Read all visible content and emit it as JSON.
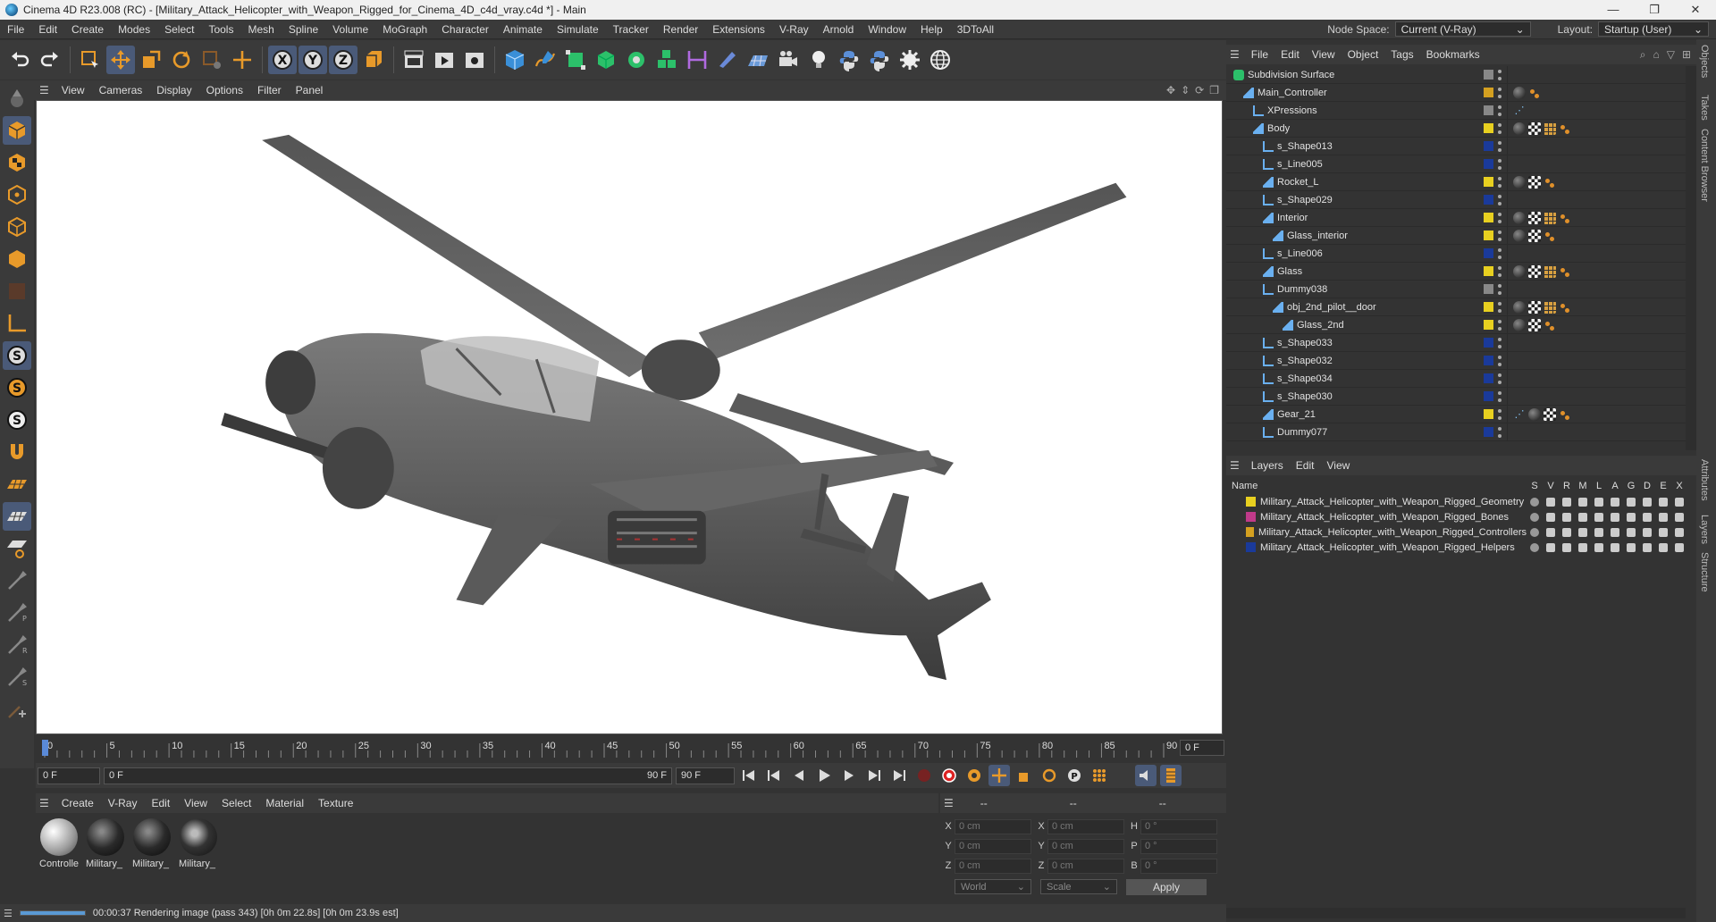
{
  "window": {
    "title": "Cinema 4D R23.008 (RC) - [Military_Attack_Helicopter_with_Weapon_Rigged_for_Cinema_4D_c4d_vray.c4d *] - Main",
    "controls": [
      "—",
      "❐",
      "✕"
    ]
  },
  "menubar": {
    "items": [
      "File",
      "Edit",
      "Create",
      "Modes",
      "Select",
      "Tools",
      "Mesh",
      "Spline",
      "Volume",
      "MoGraph",
      "Character",
      "Animate",
      "Simulate",
      "Tracker",
      "Render",
      "Extensions",
      "V-Ray",
      "Arnold",
      "Window",
      "Help",
      "3DToAll"
    ],
    "node_space_label": "Node Space:",
    "node_space_value": "Current (V-Ray)",
    "layout_label": "Layout:",
    "layout_value": "Startup (User)"
  },
  "viewport": {
    "menu": [
      "View",
      "Cameras",
      "Display",
      "Options",
      "Filter",
      "Panel"
    ]
  },
  "timeline": {
    "ticks": [
      "0",
      "5",
      "10",
      "15",
      "20",
      "25",
      "30",
      "35",
      "40",
      "45",
      "50",
      "55",
      "60",
      "65",
      "70",
      "75",
      "80",
      "85",
      "90"
    ],
    "current_frame": "0 F",
    "start_field": "0 F",
    "range_start": "0 F",
    "range_end": "90 F",
    "end_field": "90 F"
  },
  "material_manager": {
    "menu": [
      "Create",
      "V-Ray",
      "Edit",
      "View",
      "Select",
      "Material",
      "Texture"
    ],
    "materials": [
      {
        "label": "Controlle",
        "style": "white"
      },
      {
        "label": "Military_",
        "style": "dark"
      },
      {
        "label": "Military_",
        "style": "dark"
      },
      {
        "label": "Military_",
        "style": "face"
      }
    ]
  },
  "coordinates": {
    "header": [
      "--",
      "--",
      "--"
    ],
    "rows": [
      {
        "a1": "X",
        "v1": "0 cm",
        "a2": "X",
        "v2": "0 cm",
        "a3": "H",
        "v3": "0 °"
      },
      {
        "a1": "Y",
        "v1": "0 cm",
        "a2": "Y",
        "v2": "0 cm",
        "a3": "P",
        "v3": "0 °"
      },
      {
        "a1": "Z",
        "v1": "0 cm",
        "a2": "Z",
        "v2": "0 cm",
        "a3": "B",
        "v3": "0 °"
      }
    ],
    "mode": "World",
    "scale": "Scale",
    "apply_label": "Apply"
  },
  "status": {
    "text": "00:00:37 Rendering image (pass 343) [0h  0m 22.8s] [0h  0m 23.9s est]",
    "progress": 1.0
  },
  "object_manager": {
    "menu": [
      "File",
      "Edit",
      "View",
      "Object",
      "Tags",
      "Bookmarks"
    ],
    "objects": [
      {
        "name": "Subdivision Surface",
        "depth": 0,
        "icon": "subdiv",
        "flag": "#888888",
        "tags": []
      },
      {
        "name": "Main_Controller",
        "depth": 1,
        "icon": "joint",
        "flag": "#d4a020",
        "tags": [
          "sph",
          "dot3"
        ]
      },
      {
        "name": "XPressions",
        "depth": 2,
        "icon": "null",
        "flag": "#888888",
        "tags": [
          "bone"
        ]
      },
      {
        "name": "Body",
        "depth": 2,
        "icon": "joint",
        "flag": "#e8d020",
        "tags": [
          "sph",
          "chk",
          "grid",
          "dot3"
        ]
      },
      {
        "name": "s_Shape013",
        "depth": 3,
        "icon": "null",
        "flag": "#1a3a9a",
        "tags": []
      },
      {
        "name": "s_Line005",
        "depth": 3,
        "icon": "null",
        "flag": "#1a3a9a",
        "tags": []
      },
      {
        "name": "Rocket_L",
        "depth": 3,
        "icon": "joint",
        "flag": "#e8d020",
        "tags": [
          "sph",
          "chk",
          "dot3"
        ]
      },
      {
        "name": "s_Shape029",
        "depth": 3,
        "icon": "null",
        "flag": "#1a3a9a",
        "tags": []
      },
      {
        "name": "Interior",
        "depth": 3,
        "icon": "joint",
        "flag": "#e8d020",
        "tags": [
          "sph",
          "chk",
          "grid",
          "dot3"
        ]
      },
      {
        "name": "Glass_interior",
        "depth": 4,
        "icon": "joint",
        "flag": "#e8d020",
        "tags": [
          "sph",
          "chk",
          "dot3"
        ]
      },
      {
        "name": "s_Line006",
        "depth": 3,
        "icon": "null",
        "flag": "#1a3a9a",
        "tags": []
      },
      {
        "name": "Glass",
        "depth": 3,
        "icon": "joint",
        "flag": "#e8d020",
        "tags": [
          "sph",
          "chk",
          "grid",
          "dot3"
        ]
      },
      {
        "name": "Dummy038",
        "depth": 3,
        "icon": "null",
        "flag": "#888888",
        "tags": []
      },
      {
        "name": "obj_2nd_pilot__door",
        "depth": 4,
        "icon": "joint",
        "flag": "#e8d020",
        "tags": [
          "sph",
          "chk",
          "grid",
          "dot3"
        ]
      },
      {
        "name": "Glass_2nd",
        "depth": 5,
        "icon": "joint",
        "flag": "#e8d020",
        "tags": [
          "sph",
          "chk",
          "dot3"
        ]
      },
      {
        "name": "s_Shape033",
        "depth": 3,
        "icon": "null",
        "flag": "#1a3a9a",
        "tags": []
      },
      {
        "name": "s_Shape032",
        "depth": 3,
        "icon": "null",
        "flag": "#1a3a9a",
        "tags": []
      },
      {
        "name": "s_Shape034",
        "depth": 3,
        "icon": "null",
        "flag": "#1a3a9a",
        "tags": []
      },
      {
        "name": "s_Shape030",
        "depth": 3,
        "icon": "null",
        "flag": "#1a3a9a",
        "tags": []
      },
      {
        "name": "Gear_21",
        "depth": 3,
        "icon": "joint",
        "flag": "#e8d020",
        "tags": [
          "bone",
          "sph",
          "chk",
          "dot3"
        ]
      },
      {
        "name": "Dummy077",
        "depth": 3,
        "icon": "null",
        "flag": "#1a3a9a",
        "tags": []
      }
    ]
  },
  "layers": {
    "menu": [
      "Layers",
      "Edit",
      "View"
    ],
    "name_header": "Name",
    "columns": [
      "S",
      "V",
      "R",
      "M",
      "L",
      "A",
      "G",
      "D",
      "E",
      "X"
    ],
    "items": [
      {
        "name": "Military_Attack_Helicopter_with_Weapon_Rigged_Geometry",
        "color": "#e8d020"
      },
      {
        "name": "Military_Attack_Helicopter_with_Weapon_Rigged_Bones",
        "color": "#c03a8a"
      },
      {
        "name": "Military_Attack_Helicopter_with_Weapon_Rigged_Controllers",
        "color": "#d4a020"
      },
      {
        "name": "Military_Attack_Helicopter_with_Weapon_Rigged_Helpers",
        "color": "#1a3a9a"
      }
    ]
  },
  "side_tabs": [
    "Objects",
    "Takes",
    "Content Browser",
    "Attributes",
    "Layers",
    "Structure"
  ]
}
